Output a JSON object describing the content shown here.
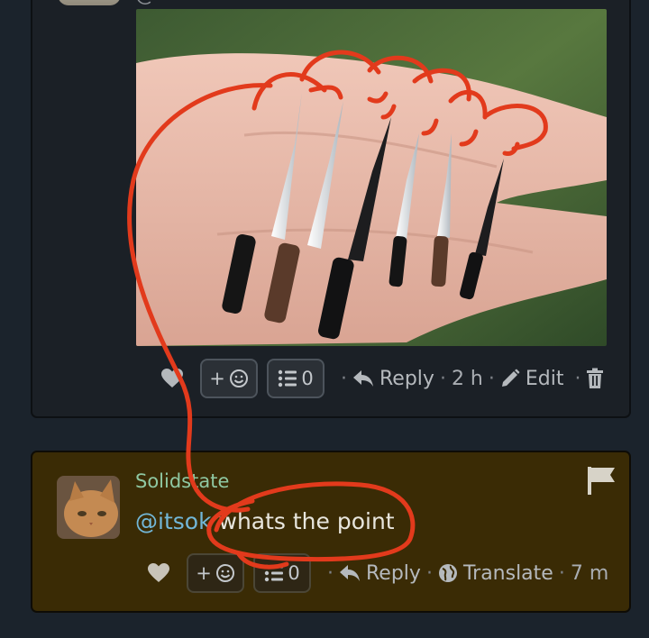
{
  "post": {
    "photo_alt": "Six miniature kitchen knives resting on an open palm",
    "actions": {
      "react_label": "+",
      "thread_count": "0",
      "reply_label": "Reply",
      "time": "2 h",
      "edit_label": "Edit"
    }
  },
  "comment": {
    "username": "Solidstate",
    "mention": "@itsok",
    "text": " whats the point",
    "actions": {
      "react_label": "+",
      "thread_count": "0",
      "reply_label": "Reply",
      "translate_label": "Translate",
      "time": "7 m"
    }
  },
  "colors": {
    "page_bg": "#1b232c",
    "post_bg": "#1b2026",
    "comment_bg": "#3a2b05",
    "username": "#8fc8a2",
    "mention": "#72b7d8",
    "annotation_red": "#e23a1c"
  },
  "icons": [
    "heart-icon",
    "smile-icon",
    "list-icon",
    "reply-arrow-icon",
    "pencil-icon",
    "trash-icon",
    "globe-icon",
    "flag-icon"
  ]
}
